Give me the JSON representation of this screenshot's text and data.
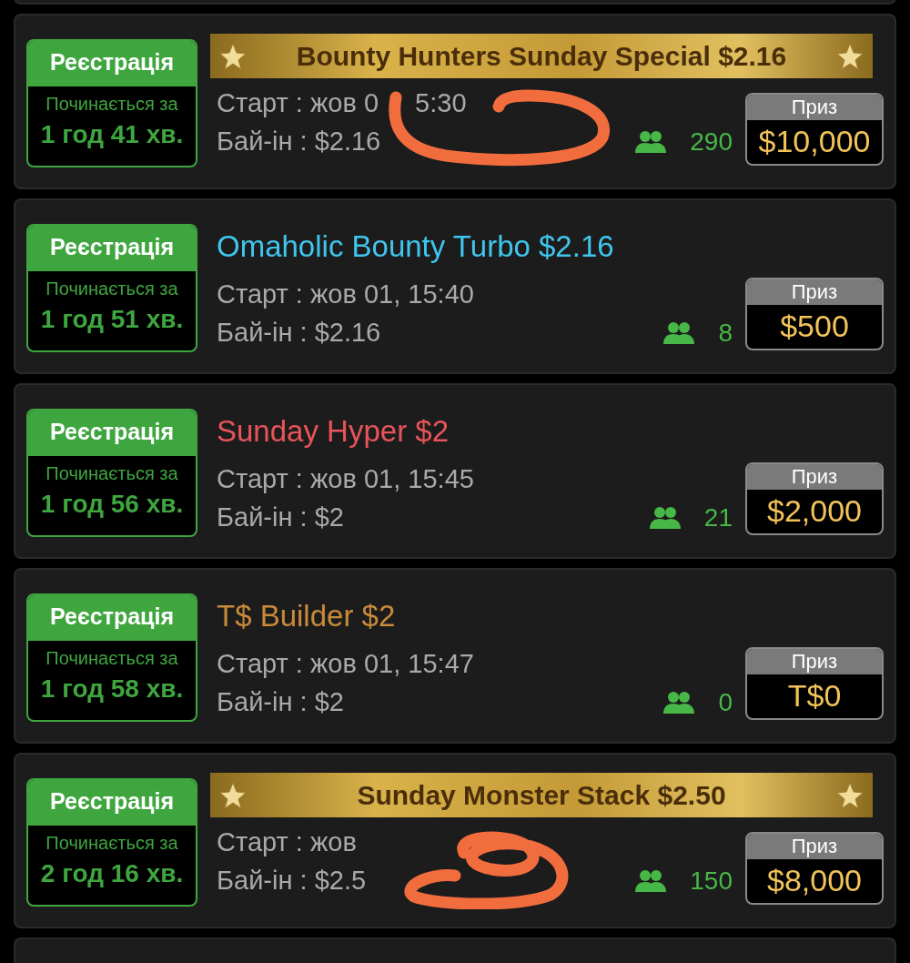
{
  "tournaments": [
    {
      "kind": "featured",
      "title": "Bounty Hunters Sunday Special $2.16",
      "color": "#4a2e0a",
      "status": "Реєстрація",
      "starts_label": "Починається за",
      "countdown": "1 год 41 хв.",
      "start": "Старт : жов 0",
      "start_tail": "5:30",
      "buyin": "Бай-ін : $2.16",
      "players": "290",
      "prize_label": "Приз",
      "prize": "$10,000",
      "scribbled": true
    },
    {
      "kind": "plain",
      "title": "Omaholic Bounty Turbo $2.16",
      "color": "#3fc6ee",
      "status": "Реєстрація",
      "starts_label": "Починається за",
      "countdown": "1 год 51 хв.",
      "start": "Старт : жов 01, 15:40",
      "buyin": "Бай-ін : $2.16",
      "players": "8",
      "prize_label": "Приз",
      "prize": "$500"
    },
    {
      "kind": "plain",
      "title": "Sunday Hyper $2",
      "color": "#e8545a",
      "status": "Реєстрація",
      "starts_label": "Починається за",
      "countdown": "1 год 56 хв.",
      "start": "Старт : жов 01, 15:45",
      "buyin": "Бай-ін : $2",
      "players": "21",
      "prize_label": "Приз",
      "prize": "$2,000"
    },
    {
      "kind": "plain",
      "title": "T$ Builder $2",
      "color": "#c98a3a",
      "status": "Реєстрація",
      "starts_label": "Починається за",
      "countdown": "1 год 58 хв.",
      "start": "Старт : жов 01, 15:47",
      "buyin": "Бай-ін : $2",
      "players": "0",
      "prize_label": "Приз",
      "prize": "T$0"
    },
    {
      "kind": "featured",
      "title": "Sunday Monster Stack $2.50",
      "color": "#4a2e0a",
      "status": "Реєстрація",
      "starts_label": "Починається за",
      "countdown": "2 год 16 хв.",
      "start": "Старт : жов",
      "buyin": "Бай-ін : $2.5",
      "players": "150",
      "prize_label": "Приз",
      "prize": "$8,000",
      "scribbled": true
    }
  ]
}
